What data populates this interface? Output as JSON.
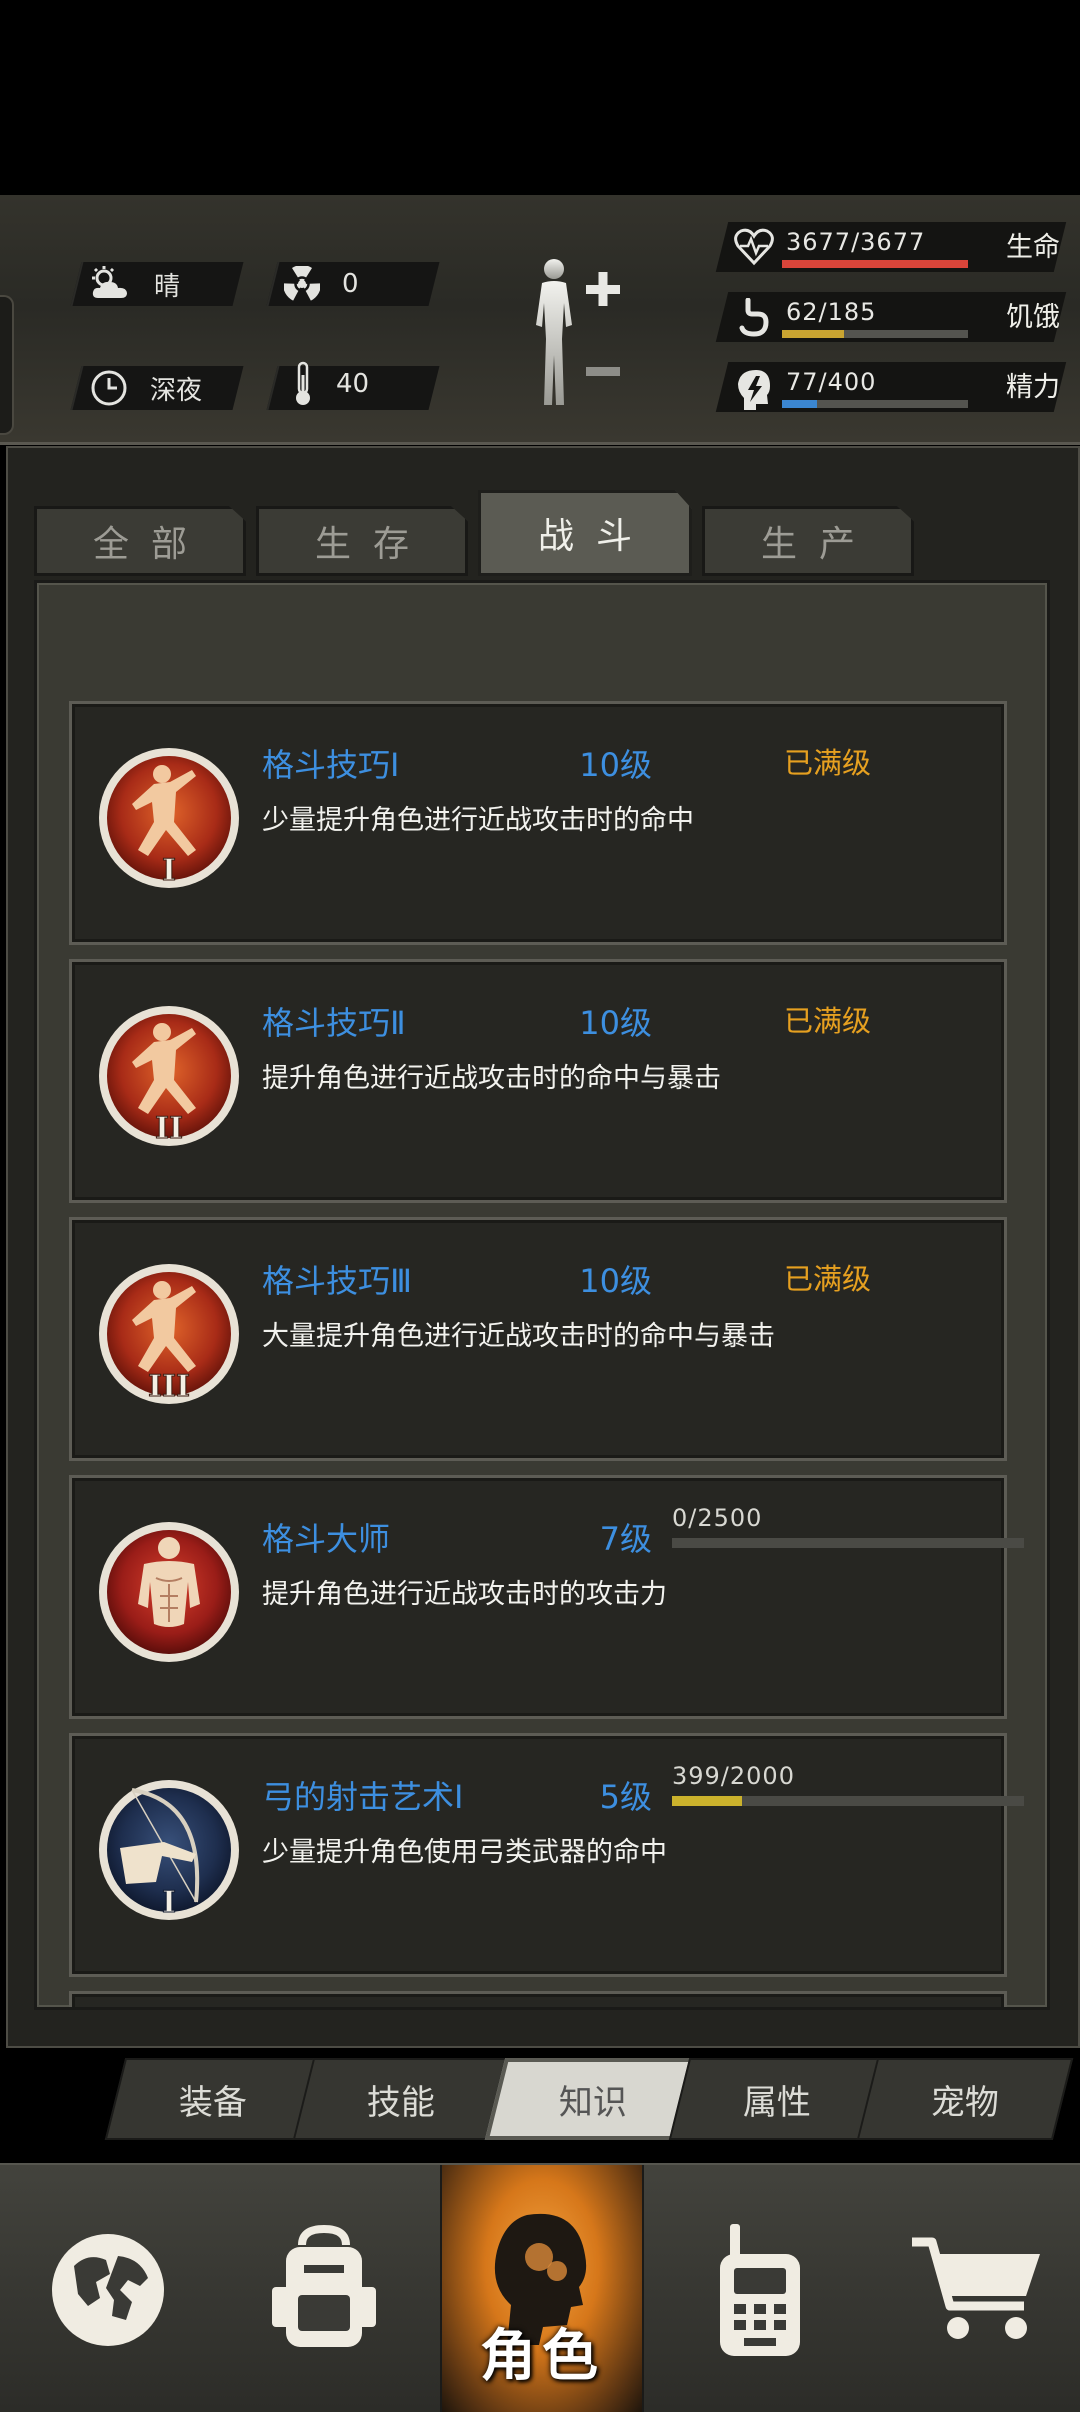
{
  "status": {
    "weather": "晴",
    "radiation": "0",
    "time_of_day": "深夜",
    "temperature": "40",
    "health": {
      "value": "3677/3677",
      "label": "生命",
      "ratio": 1.0,
      "color": "#d9453a"
    },
    "hunger": {
      "value": "62/185",
      "label": "饥饿",
      "ratio": 0.335,
      "color": "#c9a431"
    },
    "energy": {
      "value": "77/400",
      "label": "精力",
      "ratio": 0.19,
      "color": "#3b86d0"
    }
  },
  "category_tabs": [
    "全部",
    "生存",
    "战斗",
    "生产"
  ],
  "active_category": "战斗",
  "skills": [
    {
      "name": "格斗技巧Ⅰ",
      "level": "10级",
      "status": "已满级",
      "desc": "少量提升角色进行近战攻击时的命中",
      "icon": "fighter-stance-1-icon",
      "numeral": "I"
    },
    {
      "name": "格斗技巧Ⅱ",
      "level": "10级",
      "status": "已满级",
      "desc": "提升角色进行近战攻击时的命中与暴击",
      "icon": "fighter-stance-2-icon",
      "numeral": "II"
    },
    {
      "name": "格斗技巧Ⅲ",
      "level": "10级",
      "status": "已满级",
      "desc": "大量提升角色进行近战攻击时的命中与暴击",
      "icon": "fighter-stance-3-icon",
      "numeral": "III"
    },
    {
      "name": "格斗大师",
      "level": "7级",
      "progress_text": "0/2500",
      "progress": 0.0,
      "desc": "提升角色进行近战攻击时的攻击力",
      "icon": "muscle-torso-icon"
    },
    {
      "name": "弓的射击艺术Ⅰ",
      "level": "5级",
      "progress_text": "399/2000",
      "progress": 0.1995,
      "desc": "少量提升角色使用弓类武器的命中",
      "icon": "archer-1-icon",
      "numeral": "I"
    }
  ],
  "sub_tabs": [
    "装备",
    "技能",
    "知识",
    "属性",
    "宠物"
  ],
  "active_sub_tab": "知识",
  "bottom_nav": {
    "active_label": "角色",
    "items": [
      "world-map-icon",
      "backpack-icon",
      "character-icon",
      "radio-icon",
      "shopping-cart-icon"
    ]
  }
}
